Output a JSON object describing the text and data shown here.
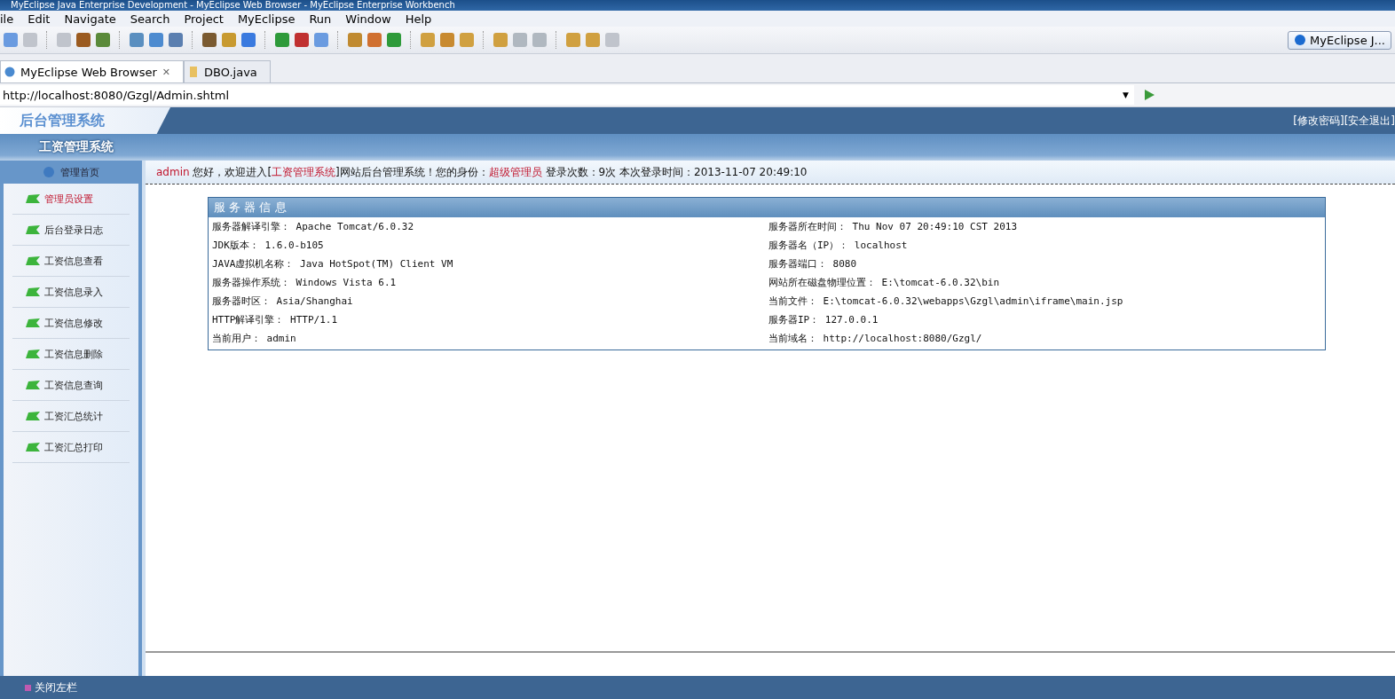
{
  "window": {
    "title": "MyEclipse Java Enterprise Development - MyEclipse Web Browser - MyEclipse Enterprise Workbench"
  },
  "menu": [
    "ile",
    "Edit",
    "Navigate",
    "Search",
    "Project",
    "MyEclipse",
    "Run",
    "Window",
    "Help"
  ],
  "perspective": {
    "label": "MyEclipse J..."
  },
  "editor_tabs": [
    {
      "label": "MyEclipse Web Browser",
      "selected": true,
      "close": "✕"
    },
    {
      "label": "DBO.java",
      "selected": false
    }
  ],
  "address": {
    "value": "http://localhost:8080/Gzgl/Admin.shtml",
    "dropdown": "▼"
  },
  "site": {
    "logo": "后台管理系统",
    "subtitle": "工资管理系统",
    "home": "管理首页",
    "top_links": [
      "[修改密码]",
      "[安全退出]"
    ],
    "welcome": [
      {
        "text": "admin",
        "highlight": true
      },
      {
        "text": " 您好，欢迎进入[",
        "highlight": false
      },
      {
        "text": "工资管理系统",
        "highlight": true
      },
      {
        "text": "]网站后台管理系统！您的身份：",
        "highlight": false
      },
      {
        "text": "超级管理员",
        "highlight": true
      },
      {
        "text": " 登录次数：9次 本次登录时间：2013-11-07 20:49:10",
        "highlight": false
      }
    ],
    "nav": [
      {
        "label": "管理员设置",
        "selected": true
      },
      {
        "label": "后台登录日志",
        "selected": false
      },
      {
        "label": "工资信息查看",
        "selected": false
      },
      {
        "label": "工资信息录入",
        "selected": false
      },
      {
        "label": "工资信息修改",
        "selected": false
      },
      {
        "label": "工资信息删除",
        "selected": false
      },
      {
        "label": "工资信息查询",
        "selected": false
      },
      {
        "label": "工资汇总统计",
        "selected": false
      },
      {
        "label": "工资汇总打印",
        "selected": false
      }
    ],
    "server_info": {
      "title": "服 务 器 信 息",
      "left": [
        {
          "label": "服务器解译引擎：",
          "value": "Apache Tomcat/6.0.32"
        },
        {
          "label": "JDK版本：",
          "value": "1.6.0-b105"
        },
        {
          "label": "JAVA虚拟机名称：",
          "value": "Java HotSpot(TM) Client VM"
        },
        {
          "label": "服务器操作系统：",
          "value": "Windows Vista 6.1"
        },
        {
          "label": "服务器时区：",
          "value": "Asia/Shanghai"
        },
        {
          "label": "HTTP解译引擎：",
          "value": "HTTP/1.1"
        },
        {
          "label": "当前用户：",
          "value": "admin"
        }
      ],
      "right": [
        {
          "label": "服务器所在时间：",
          "value": "Thu Nov 07 20:49:10 CST 2013"
        },
        {
          "label": "服务器名（IP）：",
          "value": "localhost"
        },
        {
          "label": "服务器端口：",
          "value": "8080"
        },
        {
          "label": "网站所在磁盘物理位置：",
          "value": "E:\\tomcat-6.0.32\\bin"
        },
        {
          "label": "当前文件：",
          "value": "E:\\tomcat-6.0.32\\webapps\\Gzgl\\admin\\iframe\\main.jsp"
        },
        {
          "label": "服务器IP：",
          "value": "127.0.0.1"
        },
        {
          "label": "当前域名：",
          "value": "http://localhost:8080/Gzgl/"
        }
      ]
    },
    "footer": "关闭左栏"
  }
}
